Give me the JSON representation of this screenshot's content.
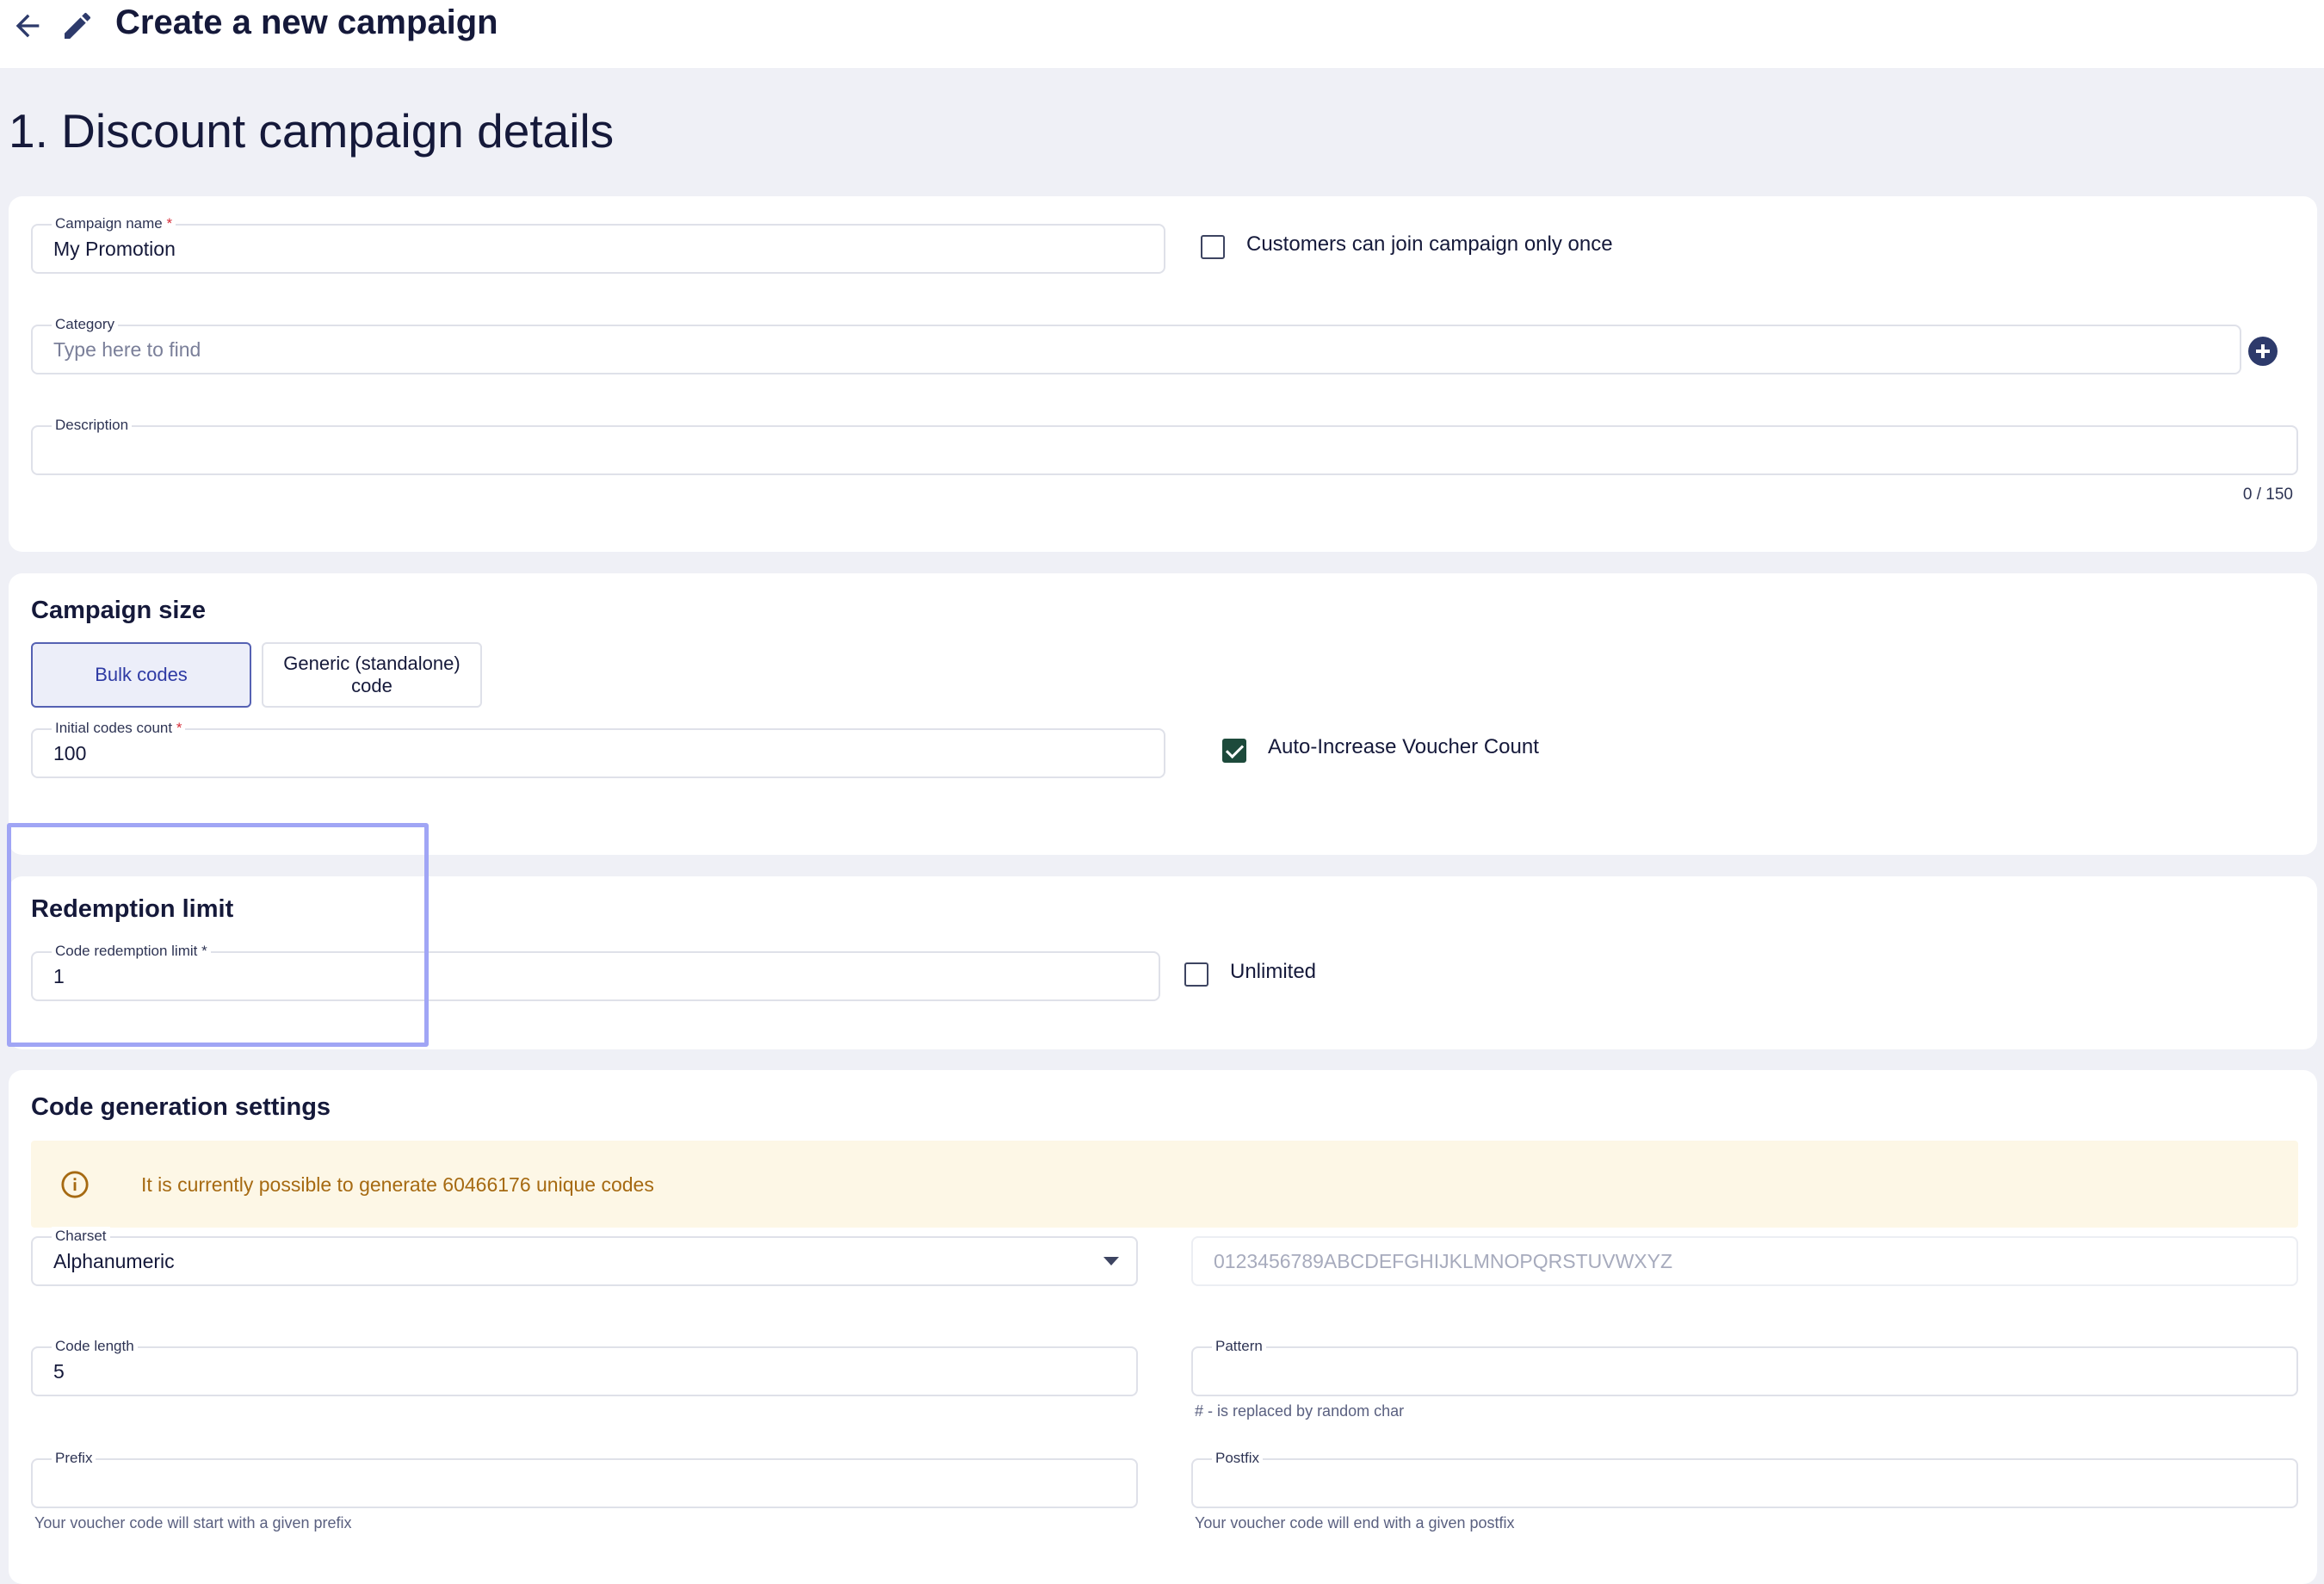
{
  "header": {
    "title": "Create a new campaign",
    "back_icon": "arrow-left-icon",
    "edit_icon": "pencil-icon"
  },
  "section": {
    "title": "1. Discount campaign details"
  },
  "details": {
    "campaign_name": {
      "label": "Campaign name",
      "required_mark": "*",
      "value": "My Promotion"
    },
    "join_once": {
      "label": "Customers can join campaign only once",
      "checked": false
    },
    "category": {
      "label": "Category",
      "placeholder": "Type here to find"
    },
    "description": {
      "label": "Description",
      "value": "",
      "counter": "0 / 150"
    }
  },
  "campaign_size": {
    "title": "Campaign size",
    "options": [
      {
        "label": "Bulk codes",
        "active": true
      },
      {
        "label": "Generic (standalone) code",
        "active": false
      }
    ],
    "initial_codes": {
      "label": "Initial codes count",
      "required_mark": "*",
      "value": "100"
    },
    "auto_increase": {
      "label": "Auto-Increase Voucher Count",
      "checked": true
    }
  },
  "redemption": {
    "title": "Redemption limit",
    "limit": {
      "label": "Code redemption limit",
      "required_mark": "*",
      "value": "1"
    },
    "unlimited": {
      "label": "Unlimited",
      "checked": false
    }
  },
  "code_generation": {
    "title": "Code generation settings",
    "info": "It is currently possible to generate 60466176 unique codes",
    "charset": {
      "label": "Charset",
      "value": "Alphanumeric"
    },
    "charset_preview": "0123456789ABCDEFGHIJKLMNOPQRSTUVWXYZ",
    "code_length": {
      "label": "Code length",
      "value": "5"
    },
    "pattern": {
      "label": "Pattern",
      "value": "",
      "hint": "# - is replaced by random char"
    },
    "prefix": {
      "label": "Prefix",
      "value": "",
      "hint": "Your voucher code will start with a given prefix"
    },
    "postfix": {
      "label": "Postfix",
      "value": "",
      "hint": "Your voucher code will end with a given postfix"
    }
  },
  "colors": {
    "primary": "#15193a",
    "accent": "#2e3aa4",
    "required": "#d72e3a",
    "checked": "#1d4a3b",
    "warning_text": "#a66a12",
    "warning_bg": "#fdf7e6",
    "highlight": "#a0a5f5"
  }
}
